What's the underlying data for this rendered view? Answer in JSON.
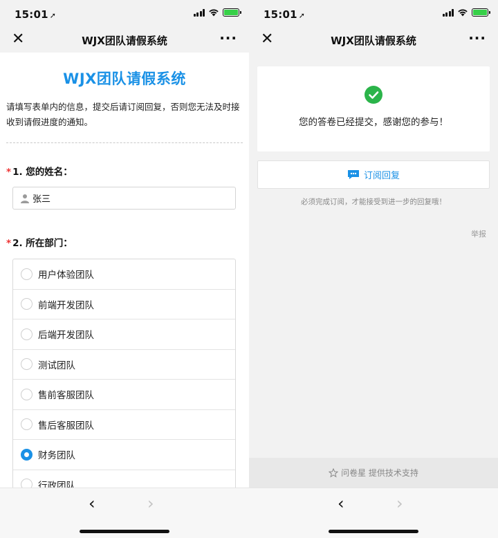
{
  "status": {
    "time": "15:01",
    "battery_color": "#37d048"
  },
  "left": {
    "nav": {
      "title": "WJX团队请假系统"
    },
    "form": {
      "title": "WJX团队请假系统",
      "intro": "请填写表单内的信息，提交后请订阅回复，否则您无法及时接收到请假进度的通知。",
      "q1": {
        "required_mark": "*",
        "label": "1. 您的姓名：",
        "value": "张三",
        "icon": "person-icon"
      },
      "q2": {
        "required_mark": "*",
        "label": "2. 所在部门：",
        "options": [
          "用户体验团队",
          "前端开发团队",
          "后端开发团队",
          "测试团队",
          "售前客服团队",
          "售后客服团队",
          "财务团队",
          "行政团队"
        ],
        "selected": "财务团队"
      }
    }
  },
  "right": {
    "nav": {
      "title": "WJX团队请假系统"
    },
    "submitted_text": "您的答卷已经提交，感谢您的参与！",
    "subscribe_label": "订阅回复",
    "notice": "必须完成订阅，才能接受到进一步的回复哦！",
    "report": "举报",
    "footer": "问卷星 提供技术支持"
  },
  "colors": {
    "accent": "#1a91e6",
    "success": "#2bb44a",
    "required": "#e33333"
  }
}
